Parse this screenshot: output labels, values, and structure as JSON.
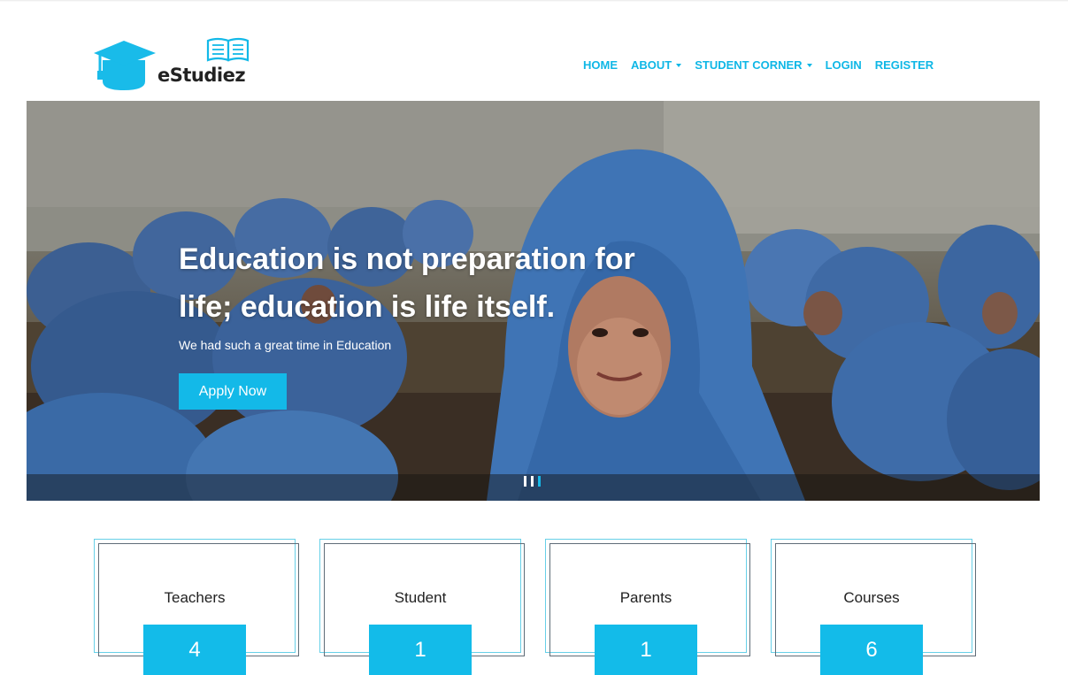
{
  "brand": {
    "name": "eStudiez",
    "primary_color": "#13b9e8",
    "logo_icon": "graduation-cap-book-icon"
  },
  "nav": {
    "items": [
      {
        "label": "HOME",
        "dropdown": false
      },
      {
        "label": "ABOUT",
        "dropdown": true
      },
      {
        "label": "STUDENT CORNER",
        "dropdown": true
      },
      {
        "label": "LOGIN",
        "dropdown": false
      },
      {
        "label": "REGISTER",
        "dropdown": false
      }
    ]
  },
  "hero": {
    "title": "Education is not preparation for life; education is life itself.",
    "subtitle": "We had such a great time in Education",
    "cta_label": "Apply Now",
    "carousel": {
      "slide_count": 3,
      "active_slide": 3
    }
  },
  "stats": [
    {
      "label": "Teachers",
      "value": "4"
    },
    {
      "label": "Student",
      "value": "1"
    },
    {
      "label": "Parents",
      "value": "1"
    },
    {
      "label": "Courses",
      "value": "6"
    }
  ]
}
